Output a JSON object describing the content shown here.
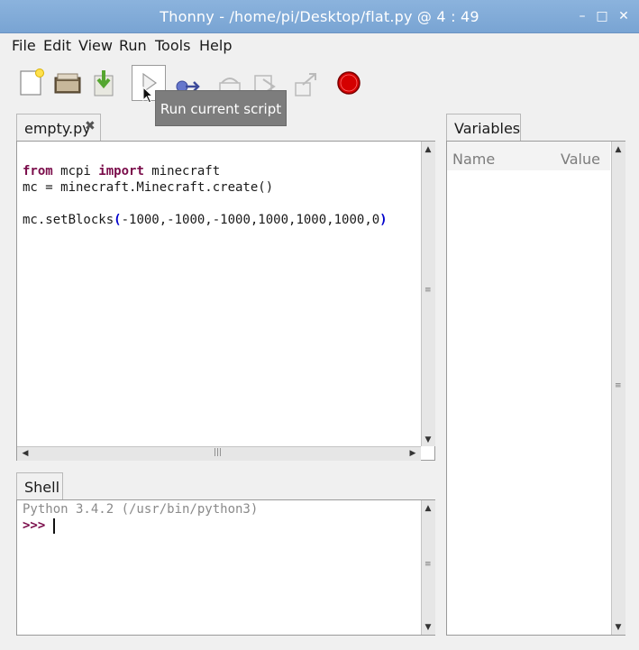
{
  "window": {
    "title": "Thonny  -  /home/pi/Desktop/flat.py  @  4 : 49",
    "controls": {
      "minimize": "–",
      "maximize": "□",
      "close": "✕"
    }
  },
  "menu": [
    "File",
    "Edit",
    "View",
    "Run",
    "Tools",
    "Help"
  ],
  "toolbar": {
    "icons": [
      "new-file-icon",
      "open-folder-icon",
      "save-icon",
      "run-icon",
      "debug-icon",
      "step-over-icon",
      "step-into-icon",
      "step-out-icon",
      "stop-icon"
    ],
    "tooltip": "Run current script"
  },
  "editor": {
    "tab_label": "empty.py",
    "tab_close": "✖",
    "lines": [
      {
        "kw1": "from",
        "t1": " mcpi ",
        "kw2": "import",
        "t2": " minecraft"
      },
      "mc = minecraft.Minecraft.create()",
      "",
      {
        "pre": "mc.setBlocks",
        "open": "(",
        "args": "-1000,-1000,-1000,1000,1000,1000,0",
        "close": ")"
      }
    ]
  },
  "shell": {
    "tab_label": "Shell",
    "version_line": "Python 3.4.2 (/usr/bin/python3)",
    "prompt": ">>>"
  },
  "variables": {
    "tab_label": "Variables",
    "columns": [
      "Name",
      "Value"
    ]
  },
  "colors": {
    "titlebar": "#79a4d3",
    "keyword": "#7a0c4a",
    "paren": "#0000cc",
    "stop_button": "#d40000",
    "tooltip_bg": "#7d7d7d"
  }
}
